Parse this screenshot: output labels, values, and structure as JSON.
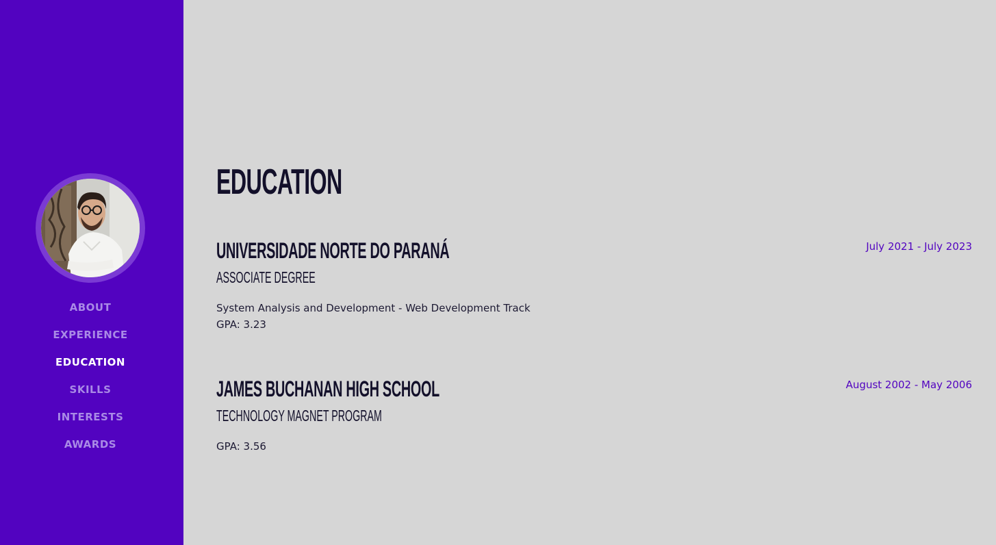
{
  "sidebar": {
    "avatar_alt": "profile photo",
    "nav": [
      {
        "label": "ABOUT",
        "active": false
      },
      {
        "label": "EXPERIENCE",
        "active": false
      },
      {
        "label": "EDUCATION",
        "active": true
      },
      {
        "label": "SKILLS",
        "active": false
      },
      {
        "label": "INTERESTS",
        "active": false
      },
      {
        "label": "AWARDS",
        "active": false
      }
    ]
  },
  "main": {
    "title": "EDUCATION",
    "entries": [
      {
        "school": "UNIVERSIDADE NORTE DO PARANÁ",
        "degree": "ASSOCIATE DEGREE",
        "date": "July 2021 - July 2023",
        "program": "System Analysis and Development - Web Development Track",
        "gpa": "GPA: 3.23"
      },
      {
        "school": "JAMES BUCHANAN HIGH SCHOOL",
        "degree": "TECHNOLOGY MAGNET PROGRAM",
        "date": "August 2002 - May 2006",
        "gpa": "GPA: 3.56"
      }
    ]
  },
  "colors": {
    "sidebar_bg": "#5203c0",
    "page_bg": "#d6d6d6",
    "accent": "#5203c0",
    "heading": "#13102a",
    "nav_inactive": "#a98ae6",
    "nav_active": "#ffffff"
  }
}
